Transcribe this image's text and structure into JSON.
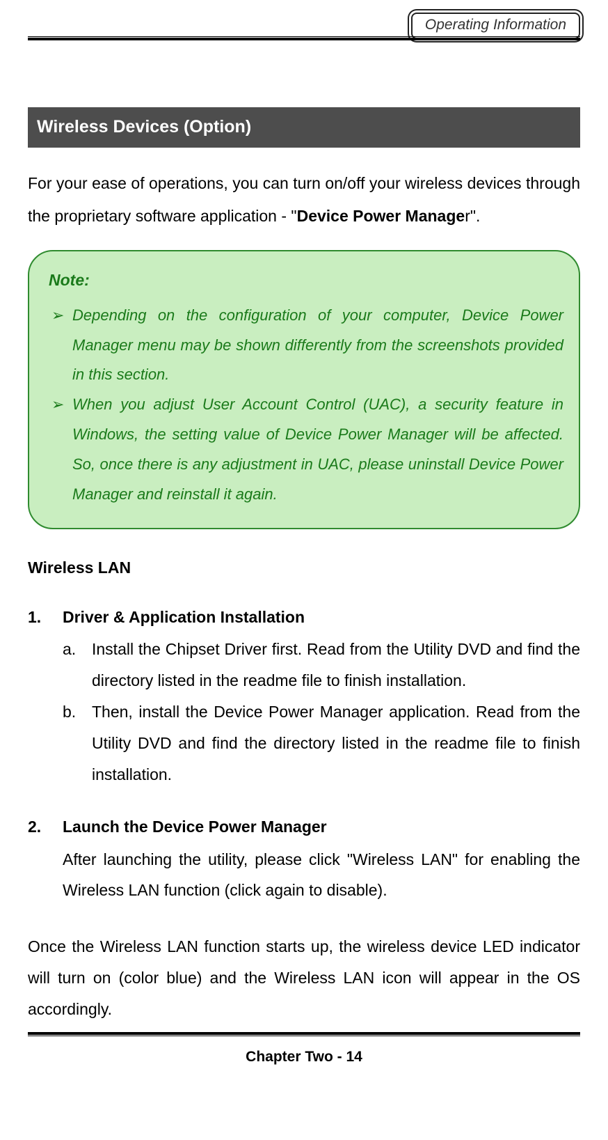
{
  "header": {
    "badge": "Operating Information"
  },
  "section": {
    "title": " Wireless Devices (Option)                                       "
  },
  "intro": {
    "pre": "For your ease of operations, you can turn on/off your wireless devices through the proprietary software application - \"",
    "bold": "Device Power Manage",
    "post": "r\"."
  },
  "note": {
    "title": "Note:",
    "items": [
      "Depending on the configuration of your computer, Device Power Manager menu may be shown differently from the screenshots provided in this section.",
      "When you adjust User Account Control (UAC), a security feature in Windows, the setting value of Device Power Manager will be affected. So, once there is any adjustment in UAC, please uninstall Device Power Manager and reinstall it again."
    ]
  },
  "subheading": "Wireless LAN",
  "steps": [
    {
      "num": "1.",
      "title": "Driver & Application Installation",
      "sub": [
        {
          "letter": "a.",
          "text": "Install the Chipset Driver first. Read from the Utility DVD and find the directory listed in the readme file to finish installation."
        },
        {
          "letter": "b.",
          "text": "Then, install the Device Power Manager application. Read from the Utility DVD and find the directory listed in the readme file to finish installation."
        }
      ]
    },
    {
      "num": "2.",
      "title": "Launch the Device Power Manager",
      "body": "After launching the utility, please click \"Wireless LAN\" for enabling the Wireless LAN function (click again to disable)."
    }
  ],
  "closing": "Once the Wireless LAN function starts up, the wireless device LED indicator will turn on (color blue) and the Wireless LAN icon will appear in the OS accordingly.",
  "footer": "Chapter Two - 14"
}
